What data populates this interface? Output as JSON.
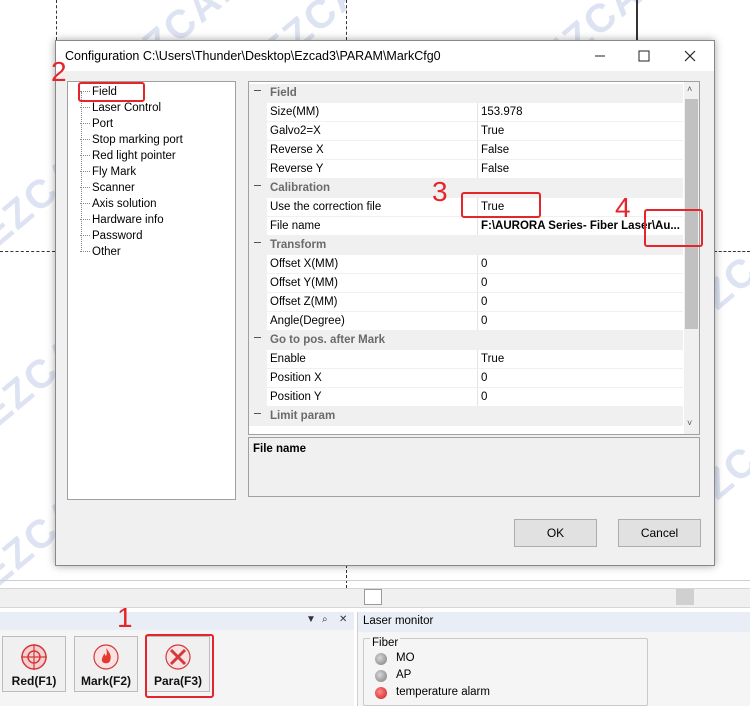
{
  "watermark": "EZCAD",
  "dialog": {
    "title": "Configuration C:\\Users\\Thunder\\Desktop\\Ezcad3\\PARAM\\MarkCfg0",
    "buttons": {
      "ok": "OK",
      "cancel": "Cancel"
    }
  },
  "tree": [
    "Field",
    "Laser Control",
    "Port",
    "Stop marking port",
    "Red light pointer",
    "Fly Mark",
    "Scanner",
    "Axis solution",
    "Hardware info",
    "Password",
    "Other"
  ],
  "grid": {
    "categories": {
      "field": "Field",
      "calibration": "Calibration",
      "transform": "Transform",
      "goto": "Go to pos. after Mark",
      "limit": "Limit param"
    },
    "rows": {
      "size": {
        "name": "Size(MM)",
        "value": "153.978"
      },
      "galvo": {
        "name": "Galvo2=X",
        "value": "True"
      },
      "revx": {
        "name": "Reverse X",
        "value": "False"
      },
      "revy": {
        "name": "Reverse Y",
        "value": "False"
      },
      "usecorr": {
        "name": "Use the correction file",
        "value": "True"
      },
      "filename": {
        "name": "File name",
        "value": "F:\\AURORA Series- Fiber Laser\\Au..."
      },
      "offx": {
        "name": "Offset X(MM)",
        "value": "0"
      },
      "offy": {
        "name": "Offset Y(MM)",
        "value": "0"
      },
      "offz": {
        "name": "Offset Z(MM)",
        "value": "0"
      },
      "angle": {
        "name": "Angle(Degree)",
        "value": "0"
      },
      "enable": {
        "name": "Enable",
        "value": "True"
      },
      "posx": {
        "name": "Position X",
        "value": "0"
      },
      "posy": {
        "name": "Position Y",
        "value": "0"
      }
    }
  },
  "description": {
    "title": "File name"
  },
  "toolbar": {
    "red": "Red(F1)",
    "mark": "Mark(F2)",
    "para": "Para(F3)"
  },
  "monitor": {
    "title": "Laser monitor",
    "group": "Fiber",
    "items": [
      "MO",
      "AP",
      "temperature alarm"
    ]
  },
  "annotations": [
    "1",
    "2",
    "3",
    "4"
  ],
  "colors": {
    "annotation": "#e4262c",
    "led_gray": "#8a8a8a",
    "led_red": "#e02020"
  }
}
